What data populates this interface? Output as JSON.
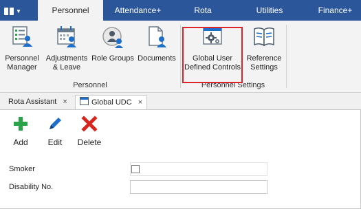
{
  "top_tabs": [
    {
      "label": "Personnel",
      "active": true
    },
    {
      "label": "Attendance+",
      "active": false
    },
    {
      "label": "Rota",
      "active": false
    },
    {
      "label": "Utilities",
      "active": false
    },
    {
      "label": "Finance+",
      "active": false
    }
  ],
  "ribbon": {
    "personnel_group": {
      "label": "Personnel",
      "buttons": [
        {
          "label": "Personnel Manager",
          "icon": "personnel-manager-icon"
        },
        {
          "label": "Adjustments & Leave",
          "icon": "calendar-person-icon"
        },
        {
          "label": "Role Groups",
          "icon": "role-groups-icon"
        },
        {
          "label": "Documents",
          "icon": "document-person-icon"
        }
      ]
    },
    "settings_group": {
      "label": "Personnel Settings",
      "buttons": [
        {
          "label": "Global User Defined Controls",
          "icon": "gear-window-icon"
        },
        {
          "label": "Reference Settings",
          "icon": "book-icon"
        }
      ]
    }
  },
  "doc_tabs": [
    {
      "label": "Rota Assistant",
      "close": "×",
      "active": false
    },
    {
      "label": "Global UDC",
      "close": "×",
      "active": true
    }
  ],
  "toolbar": {
    "add_label": "Add",
    "edit_label": "Edit",
    "delete_label": "Delete"
  },
  "form": {
    "smoker_label": "Smoker",
    "smoker_checked": false,
    "disability_label": "Disability No.",
    "disability_value": ""
  },
  "colors": {
    "tab_bar": "#2b579a",
    "ribbon_bg": "#f3f3f3",
    "highlight": "#e0202a",
    "add_green": "#2aa34a",
    "edit_blue": "#1e6fc9",
    "delete_red": "#d7261e"
  }
}
